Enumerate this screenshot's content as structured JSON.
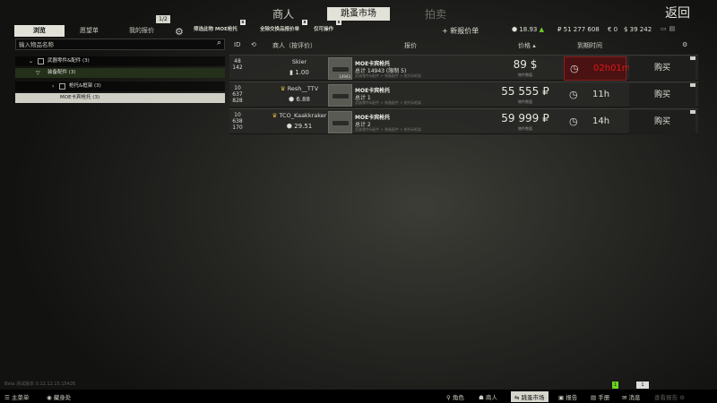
{
  "topnav": {
    "traders": "商人",
    "flea": "跳蚤市场",
    "auction": "拍卖",
    "back": "返回"
  },
  "tabs": {
    "browse": "浏览",
    "wish": "愿望单",
    "offers": "我的报价",
    "count": "1/2"
  },
  "filters": {
    "f1": "筛选此物 MOE枪托",
    "f2": "全除交换品报价单",
    "f3": "仅可操作",
    "close": "x"
  },
  "new_offer": "+ 新报价单",
  "currency": {
    "rep": "18.93",
    "rub": "₽ 51 277 608",
    "eur": "€ 0",
    "usd": "$ 39 242"
  },
  "search": {
    "placeholder": "输入物品名称"
  },
  "tree": [
    {
      "arrow": "⌄",
      "label": "武器零件&配件 (3)"
    },
    {
      "arrow": "▽",
      "label": "装备配件 (3)"
    },
    {
      "arrow": "›",
      "label": "枪托&框架 (3)"
    },
    {
      "label": "MOE卡宾枪托 (3)"
    }
  ],
  "header": {
    "id": "ID",
    "merchant": "商人（按评价）",
    "offer": "报价",
    "price": "价格 ▴",
    "expires": "到期时间"
  },
  "rows": [
    {
      "id": [
        "48",
        "142"
      ],
      "seller": "Skier",
      "rating": "1.00",
      "iname": "MOE卡宾枪托",
      "iqty": "总计 14943 (限制 5)",
      "ireq": "武器零件&配件 > 装备配件 > 枪托&框架",
      "thumb_qty": "14943",
      "price": "89 $",
      "plabel": "物件数值",
      "time": "02h01m",
      "buy": "购买"
    },
    {
      "id": [
        "10",
        "637",
        "828"
      ],
      "seller": "Resh__TTV",
      "rating": "6.88",
      "iname": "MOE卡宾枪托",
      "iqty": "总计 1",
      "ireq": "武器零件&配件 > 装备配件 > 枪托&框架",
      "thumb_qty": "",
      "price": "55 555 ₽",
      "plabel": "物件数值",
      "time": "11h",
      "buy": "购买"
    },
    {
      "id": [
        "10",
        "638",
        "170"
      ],
      "seller": "TCO_Kaakkraker",
      "rating": "29.51",
      "iname": "MOE卡宾枪托",
      "iqty": "总计 2",
      "ireq": "武器零件&配件 > 装备配件 > 枪托&框架",
      "thumb_qty": "",
      "price": "59 999 ₽",
      "plabel": "物件数值",
      "time": "14h",
      "buy": "购买"
    }
  ],
  "beta": "Beta 测试版本 0.12.12.15.15426",
  "bottombar": {
    "menu": "主菜单",
    "hideout": "藏身处",
    "character": "角色",
    "traders": "商人",
    "flea": "跳蚤市场",
    "survey": "报告",
    "handbook": "手册",
    "messages": "消息",
    "settings": "查看报告"
  },
  "notif": {
    "n1": "1",
    "n2": "1"
  }
}
